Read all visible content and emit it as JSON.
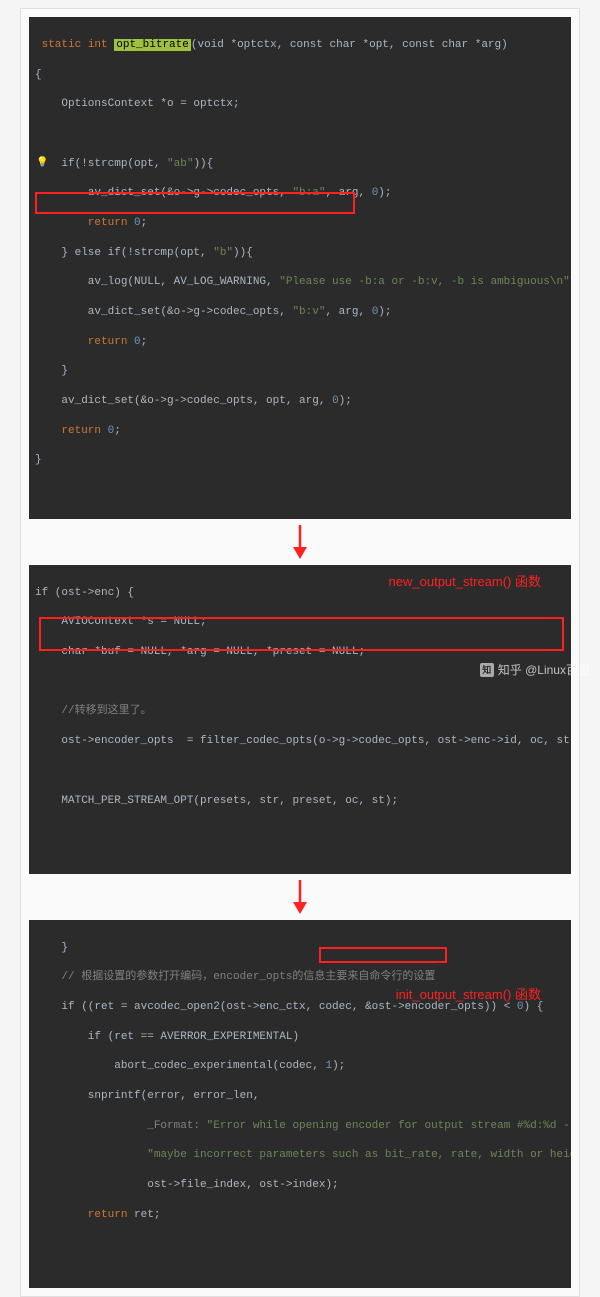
{
  "block1": {
    "l1_kw1": "static",
    "l1_type": "int",
    "l1_fn": "opt_bitrate",
    "l1_params": "(void *optctx, const char *opt, const char *arg)",
    "l2": "{",
    "l3": "    OptionsContext *o = optctx;",
    "l5a": "    if(!strcmp(opt, ",
    "l5b": "\"ab\"",
    "l5c": ")){",
    "l6a": "        av_dict_set(&o->g->codec_opts, ",
    "l6b": "\"b:a\"",
    "l6c": ", arg, ",
    "l6d": "0",
    "l6e": ");",
    "l7a": "        return ",
    "l7b": "0",
    "l7c": ";",
    "l8a": "    } else if(!strcmp(opt, ",
    "l8b": "\"b\"",
    "l8c": ")){",
    "l9a": "        av_log(NULL, AV_LOG_WARNING, ",
    "l9b": "\"Please use -b:a or -b:v, -b is ambiguous\\n\"",
    "l9c": ");",
    "l10a": "        av_dict_set(&o->g->codec_opts, ",
    "l10b": "\"b:v\"",
    "l10c": ", arg, ",
    "l10d": "0",
    "l10e": ");",
    "l11a": "        return ",
    "l11b": "0",
    "l11c": ";",
    "l12": "    }",
    "l13a": "    av_dict_set(&o->g->codec_opts, opt, arg, ",
    "l13b": "0",
    "l13c": ");",
    "l14a": "    return ",
    "l14b": "0",
    "l14c": ";",
    "l15": "}"
  },
  "block2": {
    "label": "new_output_stream() 函数",
    "l1": "if (ost->enc) {",
    "l2": "    AVIOContext *s = NULL;",
    "l3": "    char *buf = NULL, *arg = NULL, *preset = NULL;",
    "l5a": "    //转移到这里了。",
    "l6": "    ost->encoder_opts  = filter_codec_opts(o->g->codec_opts, ost->enc->id, oc, st, ost->enc);",
    "l8": "    MATCH_PER_STREAM_OPT(presets, str, preset, oc, st);"
  },
  "block3": {
    "label": "init_output_stream() 函数",
    "l1": "    }",
    "l2": "    // 根据设置的参数打开编码，encoder_opts的信息主要来自命令行的设置",
    "l3a": "    if ((ret = avcodec_open2(ost->enc_ctx, codec, ",
    "l3b": "&ost->encoder_opts",
    "l3c": ")) < ",
    "l3d": "0",
    "l3e": ") {",
    "l4": "        if (ret == AVERROR_EXPERIMENTAL)",
    "l5a": "            abort_codec_experimental(codec, ",
    "l5b": "1",
    "l5c": ");",
    "l6": "        snprintf(error, error_len,",
    "l7a": "                 _Format: ",
    "l7b": "\"Error while opening encoder for output stream #%d:%d - \"",
    "l8": "                 \"maybe incorrect parameters such as bit_rate, rate, width or height\"",
    "l9": "                 ost->file_index, ost->index);",
    "l10a": "        return ",
    "l10b": "ret",
    "l10c": ";"
  },
  "watermark": "知乎 @Linux百里"
}
